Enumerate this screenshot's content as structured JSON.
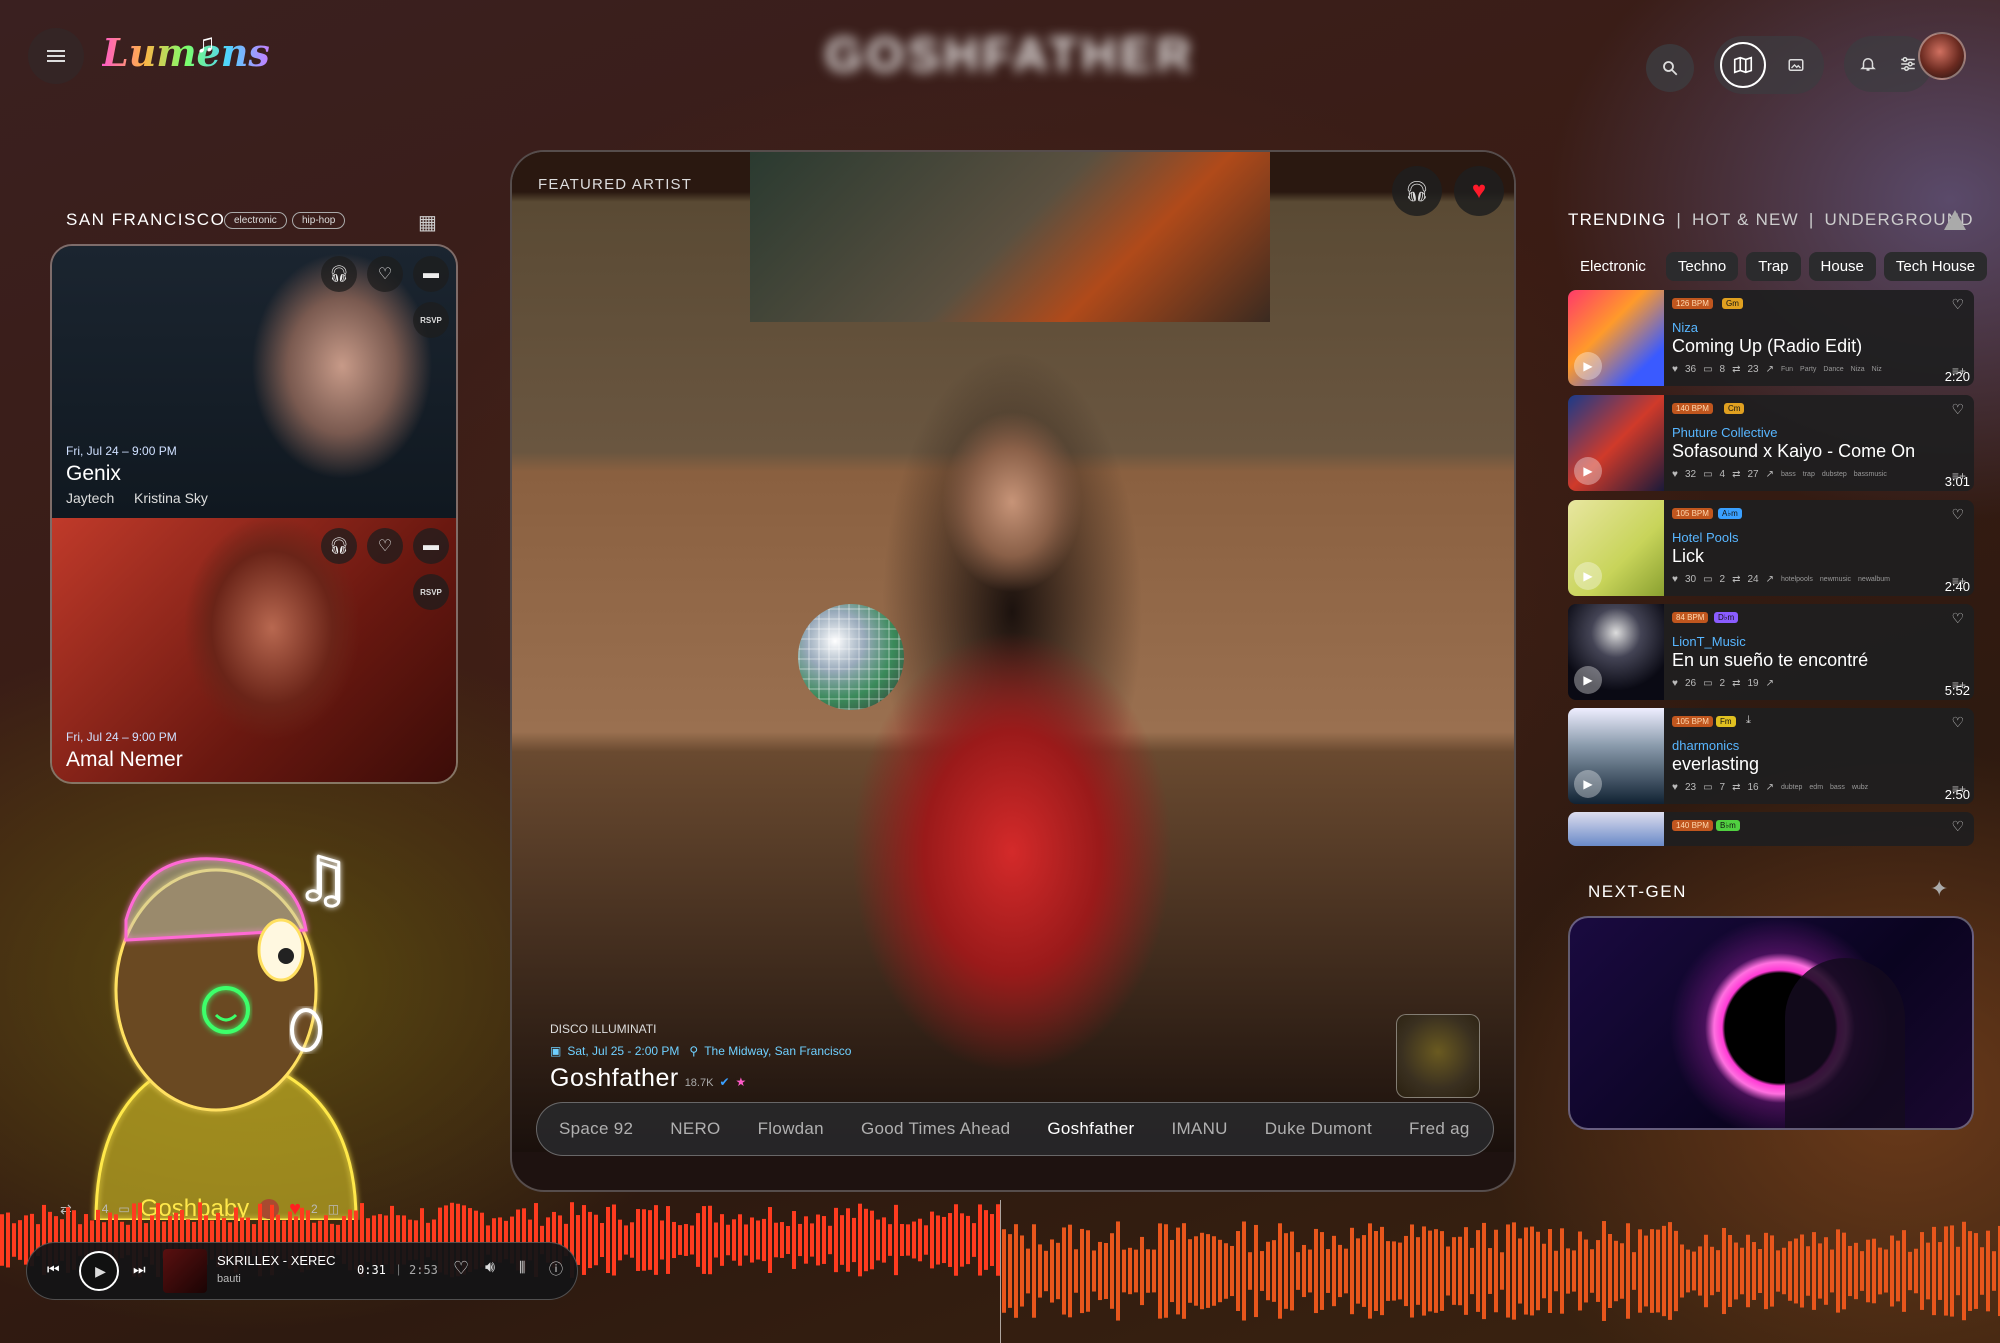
{
  "app": {
    "logo_text": "Lumens",
    "page_title": "GOSHFATHER"
  },
  "toolbar": {
    "icons": [
      "menu-icon",
      "search-icon",
      "map-icon",
      "gallery-icon",
      "notifications-icon",
      "settings-sliders-icon"
    ]
  },
  "city": {
    "name": "SAN FRANCISCO",
    "tags": [
      "electronic",
      "hip-hop"
    ]
  },
  "events": [
    {
      "date": "Fri, Jul 24 – 9:00 PM",
      "title": "Genix",
      "artists": [
        "Jaytech",
        "Kristina Sky"
      ],
      "rsvp": "RSVP"
    },
    {
      "date": "Fri, Jul 24 – 9:00 PM",
      "title": "Amal Nemer",
      "artists": [],
      "rsvp": "RSVP"
    }
  ],
  "featured": {
    "label": "FEATURED ARTIST",
    "event_name": "DISCO ILLUMINATI",
    "datetime": "Sat, Jul 25 - 2:00 PM",
    "venue": "The Midway, San Francisco",
    "artist": "Goshfather",
    "followers": "18.7K",
    "tabs": [
      "Space 92",
      "NERO",
      "Flowdan",
      "Good Times Ahead",
      "Goshfather",
      "IMANU",
      "Duke Dumont",
      "Fred ag"
    ],
    "active_tab": "Goshfather"
  },
  "trending": {
    "header": [
      "TRENDING",
      "HOT & NEW",
      "UNDERGROUND"
    ],
    "separator": "|",
    "genres": [
      "Electronic",
      "Techno",
      "Trap",
      "House",
      "Tech House"
    ],
    "tracks": [
      {
        "bpm": "126 BPM",
        "key": "Gm",
        "key_color": "#e0a020",
        "artist": "Niza",
        "title": "Coming Up (Radio Edit)",
        "likes": "36",
        "comments": "8",
        "reposts": "23",
        "duration": "2:20",
        "tags": [
          "Fun",
          "Party",
          "Dance",
          "Niza",
          "Niz"
        ]
      },
      {
        "bpm": "140 BPM",
        "key": "Cm",
        "key_color": "#e0a020",
        "artist": "Phuture Collective",
        "title": "Sofasound x Kaiyo - Come On",
        "likes": "32",
        "comments": "4",
        "reposts": "27",
        "duration": "3:01",
        "tags": [
          "bass",
          "trap",
          "dubstep",
          "bassmusic"
        ]
      },
      {
        "bpm": "105 BPM",
        "key": "A♭m",
        "key_color": "#3aa0ff",
        "artist": "Hotel Pools",
        "title": "Lick",
        "likes": "30",
        "comments": "2",
        "reposts": "24",
        "duration": "2:40",
        "tags": [
          "hotelpools",
          "newmusic",
          "newalbum"
        ]
      },
      {
        "bpm": "84 BPM",
        "key": "D♭m",
        "key_color": "#8a5cff",
        "artist": "LionT_Music",
        "title": "En un sueño te encontré",
        "likes": "26",
        "comments": "2",
        "reposts": "19",
        "duration": "5:52",
        "tags": []
      },
      {
        "bpm": "105 BPM",
        "key": "Fm",
        "key_color": "#e0c020",
        "artist": "dharmonics",
        "title": "everlasting",
        "likes": "23",
        "comments": "7",
        "reposts": "16",
        "duration": "2:50",
        "tags": [
          "dubtep",
          "edm",
          "bass",
          "wubz"
        ]
      },
      {
        "bpm": "140 BPM",
        "key": "B♭m",
        "key_color": "#50d040",
        "artist": "",
        "title": "",
        "likes": "",
        "comments": "",
        "reposts": "",
        "duration": "",
        "tags": []
      }
    ]
  },
  "next_gen": {
    "label": "NEXT-GEN"
  },
  "avatar_overlay": {
    "name": "Goshbaby",
    "comments": "4",
    "likes": "2"
  },
  "player": {
    "track": "SKRILLEX - XERECA",
    "artist": "bauti",
    "elapsed": "0:31",
    "total": "2:53",
    "progress": 0.18
  }
}
